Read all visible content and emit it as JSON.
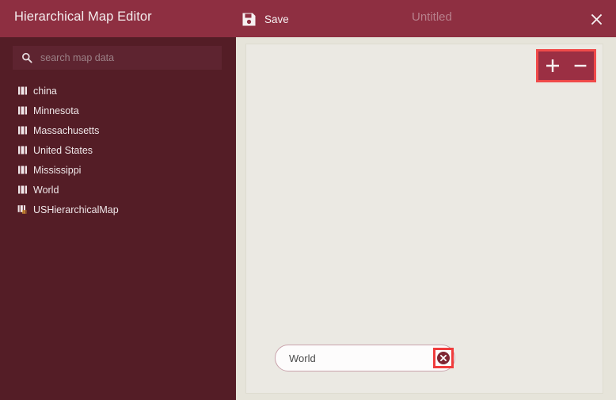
{
  "header": {
    "app_title": "Hierarchical Map Editor",
    "save_label": "Save",
    "save_icon": "floppy-disk-icon",
    "document_title": "Untitled",
    "close_icon": "close-icon",
    "background_color": "#8E2F41"
  },
  "sidebar": {
    "background_color": "#541D26",
    "search": {
      "placeholder": "search map data",
      "value": "",
      "icon": "search-icon"
    },
    "items": [
      {
        "label": "china",
        "icon": "map-file-icon"
      },
      {
        "label": "Minnesota",
        "icon": "map-file-icon"
      },
      {
        "label": "Massachusetts",
        "icon": "map-file-icon"
      },
      {
        "label": "United States",
        "icon": "map-file-icon"
      },
      {
        "label": "Mississippi",
        "icon": "map-file-icon"
      },
      {
        "label": "World",
        "icon": "map-file-icon"
      },
      {
        "label": "USHierarchicalMap",
        "icon": "hierarchical-map-file-icon"
      }
    ]
  },
  "canvas": {
    "background_color": "#EBE9E3",
    "zoom_controls": {
      "zoom_in_label": "+",
      "zoom_in_icon": "plus-icon",
      "zoom_out_label": "−",
      "zoom_out_icon": "minus-icon",
      "highlight_color": "#F04A4A",
      "background_color": "#9B2F43"
    },
    "node_input": {
      "value": "World",
      "placeholder": "",
      "clear_icon": "clear-circle-x-icon",
      "highlight_color": "#F03C3C"
    }
  }
}
